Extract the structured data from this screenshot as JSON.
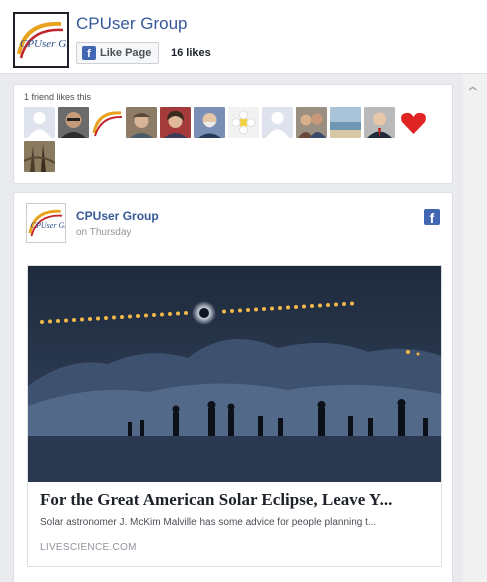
{
  "header": {
    "page_name": "CPUser Group",
    "like_label": "Like Page",
    "likes_count": "16 likes",
    "logo_text": "CPUser Group"
  },
  "friends": {
    "label": "1 friend likes this",
    "avatars": [
      "default-avatar",
      "man-glasses",
      "cpuser-logo",
      "man-cap",
      "woman",
      "bearded-man",
      "flower",
      "default-avatar",
      "couple",
      "beach",
      "man-suit",
      "heart",
      "tree"
    ]
  },
  "post": {
    "author": "CPUser Group",
    "time": "on Thursday",
    "link_title": "For the Great American Solar Eclipse, Leave Y...",
    "link_description": "Solar astronomer J. McKim Malville has some advice for people planning t...",
    "link_domain": "LIVESCIENCE.COM"
  },
  "colors": {
    "brand_blue": "#4267b2",
    "link_blue": "#365899",
    "background": "#e9ebee"
  }
}
